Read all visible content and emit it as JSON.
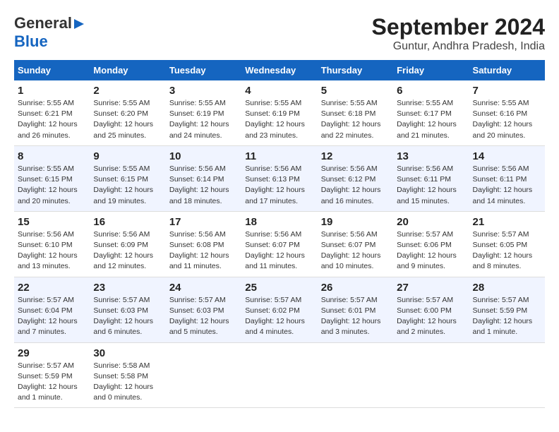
{
  "logo": {
    "line1": "General",
    "line2": "Blue"
  },
  "title": "September 2024",
  "subtitle": "Guntur, Andhra Pradesh, India",
  "days_of_week": [
    "Sunday",
    "Monday",
    "Tuesday",
    "Wednesday",
    "Thursday",
    "Friday",
    "Saturday"
  ],
  "weeks": [
    [
      {
        "day": "1",
        "sunrise": "Sunrise: 5:55 AM",
        "sunset": "Sunset: 6:21 PM",
        "daylight": "Daylight: 12 hours and 26 minutes."
      },
      {
        "day": "2",
        "sunrise": "Sunrise: 5:55 AM",
        "sunset": "Sunset: 6:20 PM",
        "daylight": "Daylight: 12 hours and 25 minutes."
      },
      {
        "day": "3",
        "sunrise": "Sunrise: 5:55 AM",
        "sunset": "Sunset: 6:19 PM",
        "daylight": "Daylight: 12 hours and 24 minutes."
      },
      {
        "day": "4",
        "sunrise": "Sunrise: 5:55 AM",
        "sunset": "Sunset: 6:19 PM",
        "daylight": "Daylight: 12 hours and 23 minutes."
      },
      {
        "day": "5",
        "sunrise": "Sunrise: 5:55 AM",
        "sunset": "Sunset: 6:18 PM",
        "daylight": "Daylight: 12 hours and 22 minutes."
      },
      {
        "day": "6",
        "sunrise": "Sunrise: 5:55 AM",
        "sunset": "Sunset: 6:17 PM",
        "daylight": "Daylight: 12 hours and 21 minutes."
      },
      {
        "day": "7",
        "sunrise": "Sunrise: 5:55 AM",
        "sunset": "Sunset: 6:16 PM",
        "daylight": "Daylight: 12 hours and 20 minutes."
      }
    ],
    [
      {
        "day": "8",
        "sunrise": "Sunrise: 5:55 AM",
        "sunset": "Sunset: 6:15 PM",
        "daylight": "Daylight: 12 hours and 20 minutes."
      },
      {
        "day": "9",
        "sunrise": "Sunrise: 5:55 AM",
        "sunset": "Sunset: 6:15 PM",
        "daylight": "Daylight: 12 hours and 19 minutes."
      },
      {
        "day": "10",
        "sunrise": "Sunrise: 5:56 AM",
        "sunset": "Sunset: 6:14 PM",
        "daylight": "Daylight: 12 hours and 18 minutes."
      },
      {
        "day": "11",
        "sunrise": "Sunrise: 5:56 AM",
        "sunset": "Sunset: 6:13 PM",
        "daylight": "Daylight: 12 hours and 17 minutes."
      },
      {
        "day": "12",
        "sunrise": "Sunrise: 5:56 AM",
        "sunset": "Sunset: 6:12 PM",
        "daylight": "Daylight: 12 hours and 16 minutes."
      },
      {
        "day": "13",
        "sunrise": "Sunrise: 5:56 AM",
        "sunset": "Sunset: 6:11 PM",
        "daylight": "Daylight: 12 hours and 15 minutes."
      },
      {
        "day": "14",
        "sunrise": "Sunrise: 5:56 AM",
        "sunset": "Sunset: 6:11 PM",
        "daylight": "Daylight: 12 hours and 14 minutes."
      }
    ],
    [
      {
        "day": "15",
        "sunrise": "Sunrise: 5:56 AM",
        "sunset": "Sunset: 6:10 PM",
        "daylight": "Daylight: 12 hours and 13 minutes."
      },
      {
        "day": "16",
        "sunrise": "Sunrise: 5:56 AM",
        "sunset": "Sunset: 6:09 PM",
        "daylight": "Daylight: 12 hours and 12 minutes."
      },
      {
        "day": "17",
        "sunrise": "Sunrise: 5:56 AM",
        "sunset": "Sunset: 6:08 PM",
        "daylight": "Daylight: 12 hours and 11 minutes."
      },
      {
        "day": "18",
        "sunrise": "Sunrise: 5:56 AM",
        "sunset": "Sunset: 6:07 PM",
        "daylight": "Daylight: 12 hours and 11 minutes."
      },
      {
        "day": "19",
        "sunrise": "Sunrise: 5:56 AM",
        "sunset": "Sunset: 6:07 PM",
        "daylight": "Daylight: 12 hours and 10 minutes."
      },
      {
        "day": "20",
        "sunrise": "Sunrise: 5:57 AM",
        "sunset": "Sunset: 6:06 PM",
        "daylight": "Daylight: 12 hours and 9 minutes."
      },
      {
        "day": "21",
        "sunrise": "Sunrise: 5:57 AM",
        "sunset": "Sunset: 6:05 PM",
        "daylight": "Daylight: 12 hours and 8 minutes."
      }
    ],
    [
      {
        "day": "22",
        "sunrise": "Sunrise: 5:57 AM",
        "sunset": "Sunset: 6:04 PM",
        "daylight": "Daylight: 12 hours and 7 minutes."
      },
      {
        "day": "23",
        "sunrise": "Sunrise: 5:57 AM",
        "sunset": "Sunset: 6:03 PM",
        "daylight": "Daylight: 12 hours and 6 minutes."
      },
      {
        "day": "24",
        "sunrise": "Sunrise: 5:57 AM",
        "sunset": "Sunset: 6:03 PM",
        "daylight": "Daylight: 12 hours and 5 minutes."
      },
      {
        "day": "25",
        "sunrise": "Sunrise: 5:57 AM",
        "sunset": "Sunset: 6:02 PM",
        "daylight": "Daylight: 12 hours and 4 minutes."
      },
      {
        "day": "26",
        "sunrise": "Sunrise: 5:57 AM",
        "sunset": "Sunset: 6:01 PM",
        "daylight": "Daylight: 12 hours and 3 minutes."
      },
      {
        "day": "27",
        "sunrise": "Sunrise: 5:57 AM",
        "sunset": "Sunset: 6:00 PM",
        "daylight": "Daylight: 12 hours and 2 minutes."
      },
      {
        "day": "28",
        "sunrise": "Sunrise: 5:57 AM",
        "sunset": "Sunset: 5:59 PM",
        "daylight": "Daylight: 12 hours and 1 minute."
      }
    ],
    [
      {
        "day": "29",
        "sunrise": "Sunrise: 5:57 AM",
        "sunset": "Sunset: 5:59 PM",
        "daylight": "Daylight: 12 hours and 1 minute."
      },
      {
        "day": "30",
        "sunrise": "Sunrise: 5:58 AM",
        "sunset": "Sunset: 5:58 PM",
        "daylight": "Daylight: 12 hours and 0 minutes."
      },
      null,
      null,
      null,
      null,
      null
    ]
  ]
}
